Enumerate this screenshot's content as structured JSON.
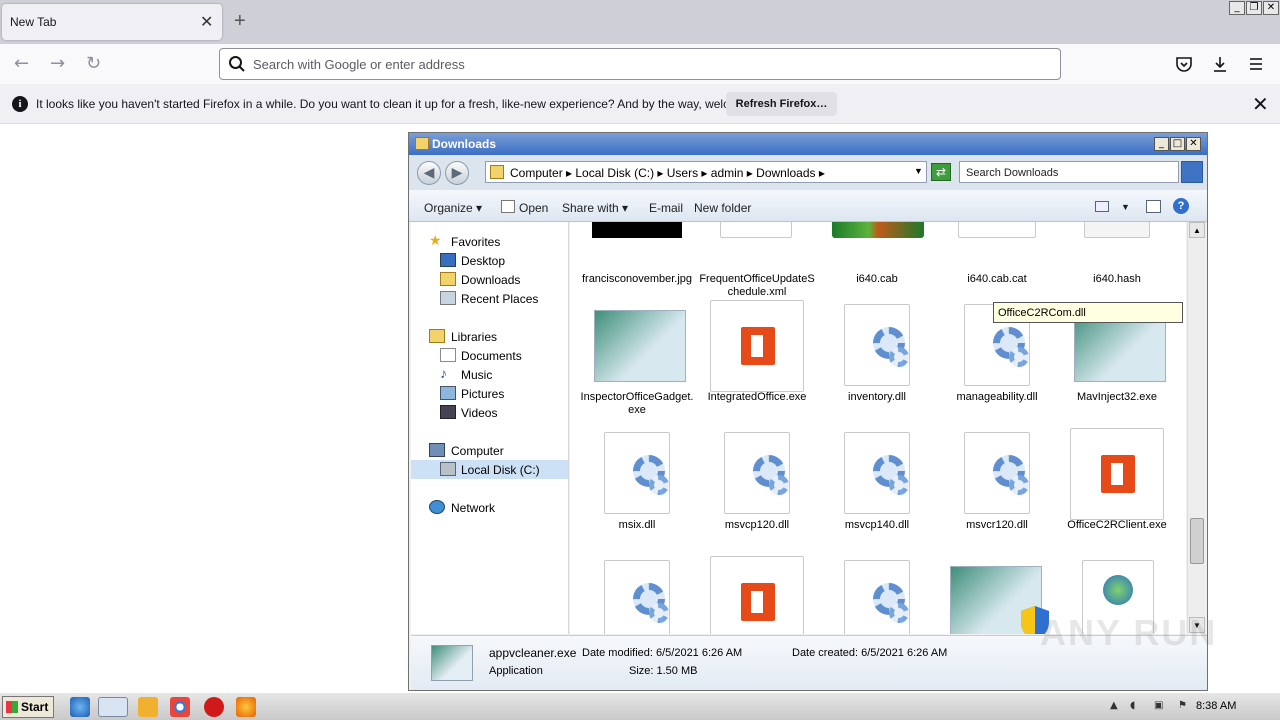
{
  "browser": {
    "tab_title": "New Tab",
    "tab_close": "✕",
    "new_tab": "+",
    "url_placeholder": "Search with Google or enter address",
    "notification": {
      "message": "It looks like you haven't started Firefox in a while. Do you want to clean it up for a fresh, like-new experience? And by the way, welcome back!",
      "button": "Refresh Firefox…",
      "close": "✕"
    }
  },
  "explorer": {
    "title": "Downloads",
    "breadcrumb": "Computer  ▸  Local Disk (C:)  ▸  Users  ▸  admin  ▸  Downloads  ▸",
    "search_placeholder": "Search Downloads",
    "toolbar": {
      "organize": "Organize  ▾",
      "open": "Open",
      "share_with": "Share with  ▾",
      "email": "E-mail",
      "new_folder": "New folder"
    },
    "nav": {
      "favorites": "Favorites",
      "desktop": "Desktop",
      "downloads": "Downloads",
      "recent_places": "Recent Places",
      "libraries": "Libraries",
      "documents": "Documents",
      "music": "Music",
      "pictures": "Pictures",
      "videos": "Videos",
      "computer": "Computer",
      "local_disk": "Local Disk (C:)",
      "network": "Network"
    },
    "files": [
      {
        "name": "francisconovember.jpg",
        "icon": "black-image"
      },
      {
        "name": "FrequentOfficeUpdateSchedule.xml",
        "icon": "document"
      },
      {
        "name": "i640.cab",
        "icon": "winrar-archive"
      },
      {
        "name": "i640.cab.cat",
        "icon": "certificate-catalog"
      },
      {
        "name": "i640.hash",
        "icon": "blank-file"
      },
      {
        "name": "InspectorOfficeGadget.exe",
        "icon": "application"
      },
      {
        "name": "IntegratedOffice.exe",
        "icon": "office"
      },
      {
        "name": "inventory.dll",
        "icon": "dll-gear"
      },
      {
        "name": "manageability.dll",
        "icon": "dll-gear"
      },
      {
        "name": "MavInject32.exe",
        "icon": "application"
      },
      {
        "name": "msix.dll",
        "icon": "dll-gear"
      },
      {
        "name": "msvcp120.dll",
        "icon": "dll-gear"
      },
      {
        "name": "msvcp140.dll",
        "icon": "dll-gear"
      },
      {
        "name": "msvcr120.dll",
        "icon": "dll-gear"
      },
      {
        "name": "OfficeC2RClient.exe",
        "icon": "office"
      },
      {
        "name": "",
        "icon": "dll-gear"
      },
      {
        "name": "",
        "icon": "office"
      },
      {
        "name": "",
        "icon": "dll-gear"
      },
      {
        "name": "",
        "icon": "application-shield"
      },
      {
        "name": "",
        "icon": "web-document"
      }
    ],
    "tooltip": "OfficeC2RCom.dll",
    "details": {
      "filename": "appvcleaner.exe",
      "type": "Application",
      "date_modified": "Date modified:  6/5/2021 6:26 AM",
      "size": "Size:  1.50 MB",
      "date_created": "Date created:  6/5/2021 6:26 AM"
    }
  },
  "taskbar": {
    "start": "Start",
    "clock": "8:38 AM"
  },
  "watermark": "ANY RUN",
  "colors": {
    "titlebar": "#3b6fc4",
    "selection": "#cde1f6",
    "office": "#e64a19"
  }
}
